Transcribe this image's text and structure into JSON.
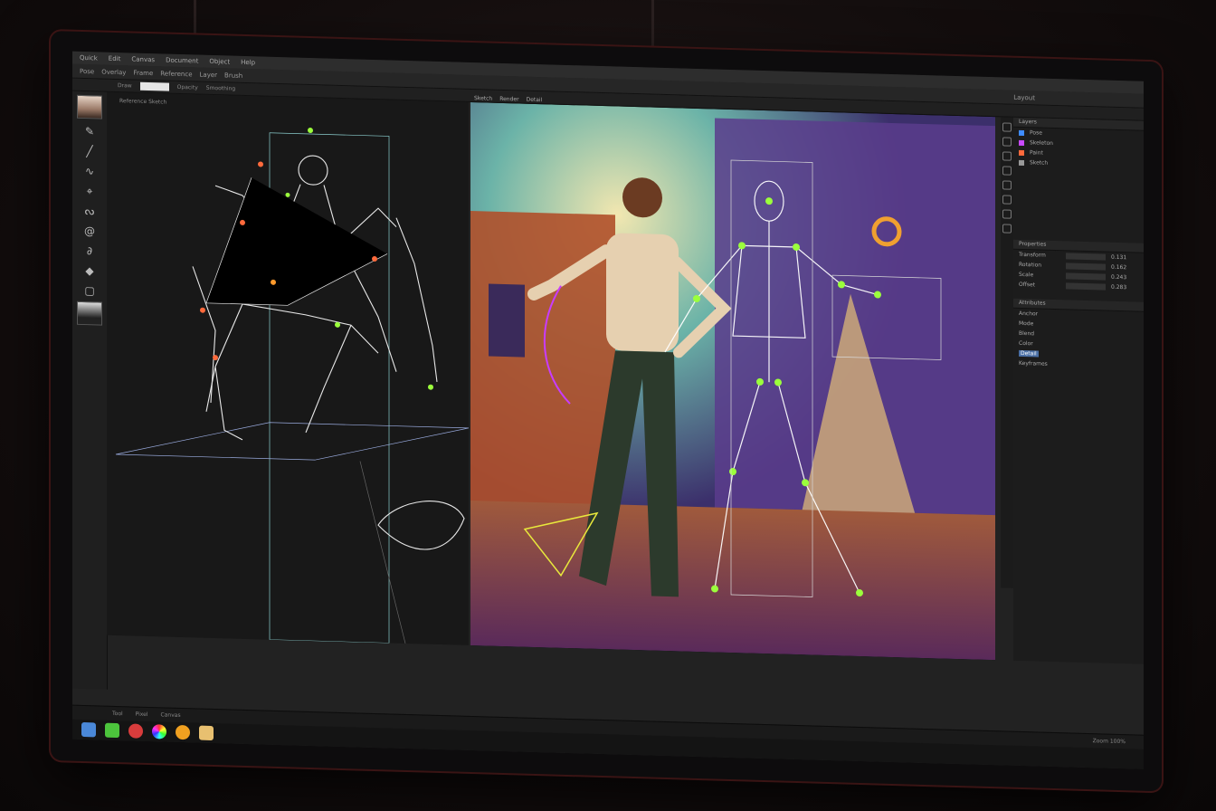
{
  "app": {
    "menu": [
      "Quick",
      "Edit",
      "Canvas",
      "Document",
      "Object",
      "Help"
    ],
    "toolbar": [
      "Pose",
      "Overlay",
      "Frame",
      "Reference",
      "Layer",
      "Brush"
    ],
    "options": [
      "Draw",
      "Opacity",
      "Smoothing"
    ],
    "tabs": [
      "Sketch",
      "Render",
      "Detail"
    ],
    "left_label": "Reference Sketch",
    "workspace": "Layout"
  },
  "right_panel": {
    "layers_title": "Layers",
    "layers": [
      {
        "name": "Pose",
        "color": "#3f8cff"
      },
      {
        "name": "Skeleton",
        "color": "#c84aff"
      },
      {
        "name": "Paint",
        "color": "#ff6a3c"
      },
      {
        "name": "Sketch",
        "color": "#999999"
      }
    ],
    "props_title": "Properties",
    "props": [
      {
        "label": "Transform",
        "value": "0.131"
      },
      {
        "label": "Rotation",
        "value": "0.162"
      },
      {
        "label": "Scale",
        "value": "0.243"
      },
      {
        "label": "Offset",
        "value": "0.283"
      }
    ],
    "attrs_title": "Attributes",
    "attrs": [
      "Anchor",
      "Mode",
      "Blend",
      "Color",
      "Detail",
      "Keyframes"
    ],
    "selected_attr": "Detail"
  },
  "statusbar": {
    "left": [
      "Tool",
      "Pixel",
      "Canvas"
    ],
    "right": "Zoom 100%"
  },
  "taskbar_icons": [
    "finder",
    "app-green",
    "app-red",
    "color-wheel",
    "gear",
    "folder"
  ],
  "colors": {
    "accent": "#4a6fa5",
    "pose": "#9bff3c",
    "skeleton": "#ffffff"
  }
}
